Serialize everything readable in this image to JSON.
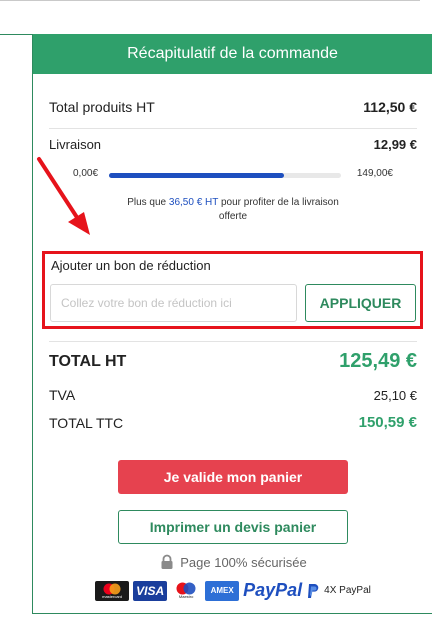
{
  "summary": {
    "header_title": "Récapitulatif de la commande",
    "total_products_label": "Total produits HT",
    "total_products_value": "112,50 €",
    "shipping_label": "Livraison",
    "shipping_value": "12,99 €",
    "shipping_progress": {
      "min_label": "0,00€",
      "max_label": "149,00€",
      "fraction": 0.755,
      "fill_color": "#1e4fbf"
    },
    "free_shipping_prefix": "Plus que ",
    "free_shipping_amount": "36,50 € HT",
    "free_shipping_suffix": " pour profiter de la livraison offerte",
    "coupon": {
      "label": "Ajouter un bon de réduction",
      "placeholder": "Collez votre bon de réduction ici",
      "value": "",
      "apply_label": "APPLIQUER"
    },
    "total_ht_label": "TOTAL HT",
    "total_ht_value": "125,49 €",
    "tva_label": "TVA",
    "tva_value": "25,10 €",
    "total_ttc_label": "TOTAL TTC",
    "total_ttc_value": "150,59 €",
    "validate_label": "Je valide mon panier",
    "print_quote_label": "Imprimer un devis panier",
    "secure_label": "Page 100% sécurisée",
    "payments": {
      "mastercard": "mastercard",
      "visa": "VISA",
      "maestro": "Maestro",
      "amex": "AMEX",
      "paypal": "PayPal",
      "paypal_4x": "4X PayPal"
    }
  },
  "colors": {
    "brand_green": "#2fa06b",
    "highlight_red": "#e6131b",
    "validate_red": "#e6424f",
    "link_blue": "#1e4fbf"
  },
  "icons": [
    "lock-icon",
    "mastercard-icon",
    "visa-icon",
    "maestro-icon",
    "amex-icon",
    "paypal-icon",
    "annotation-arrow-icon"
  ]
}
